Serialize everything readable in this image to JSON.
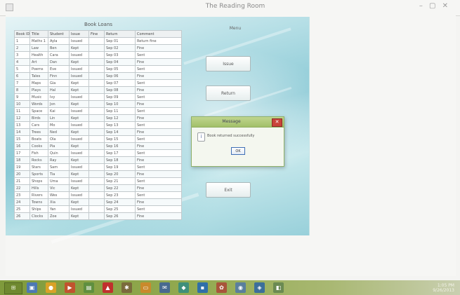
{
  "window": {
    "title": "The Reading Room",
    "controls": "– ▢ ✕"
  },
  "table": {
    "title": "Book Loans",
    "columns": [
      "Book ID",
      "Title",
      "Student",
      "Issue",
      "Fine",
      "Return",
      "Comment"
    ],
    "rows": [
      [
        "1",
        "Maths 1",
        "Ayla",
        "Issued",
        "",
        "Sep 01",
        "Return fine"
      ],
      [
        "2",
        "Law",
        "Ben",
        "Kept",
        "",
        "Sep 02",
        "Fine"
      ],
      [
        "3",
        "Health",
        "Cara",
        "Issued",
        "",
        "Sep 03",
        "Sent"
      ],
      [
        "4",
        "Art",
        "Dan",
        "Kept",
        "",
        "Sep 04",
        "Fine"
      ],
      [
        "5",
        "Poems",
        "Eve",
        "Issued",
        "",
        "Sep 05",
        "Sent"
      ],
      [
        "6",
        "Tales",
        "Finn",
        "Issued",
        "",
        "Sep 06",
        "Fine"
      ],
      [
        "7",
        "Maps",
        "Gia",
        "Kept",
        "",
        "Sep 07",
        "Sent"
      ],
      [
        "8",
        "Plays",
        "Hal",
        "Kept",
        "",
        "Sep 08",
        "Fine"
      ],
      [
        "9",
        "Music",
        "Ivy",
        "Issued",
        "",
        "Sep 09",
        "Sent"
      ],
      [
        "10",
        "Words",
        "Jon",
        "Kept",
        "",
        "Sep 10",
        "Fine"
      ],
      [
        "11",
        "Space",
        "Kai",
        "Issued",
        "",
        "Sep 11",
        "Sent"
      ],
      [
        "12",
        "Birds",
        "Lin",
        "Kept",
        "",
        "Sep 12",
        "Fine"
      ],
      [
        "13",
        "Cars",
        "Mo",
        "Issued",
        "",
        "Sep 13",
        "Sent"
      ],
      [
        "14",
        "Trees",
        "Ned",
        "Kept",
        "",
        "Sep 14",
        "Fine"
      ],
      [
        "15",
        "Boats",
        "Ola",
        "Issued",
        "",
        "Sep 15",
        "Sent"
      ],
      [
        "16",
        "Cooks",
        "Pia",
        "Kept",
        "",
        "Sep 16",
        "Fine"
      ],
      [
        "17",
        "Fish",
        "Quin",
        "Issued",
        "",
        "Sep 17",
        "Sent"
      ],
      [
        "18",
        "Rocks",
        "Ray",
        "Kept",
        "",
        "Sep 18",
        "Fine"
      ],
      [
        "19",
        "Stars",
        "Sam",
        "Issued",
        "",
        "Sep 19",
        "Sent"
      ],
      [
        "20",
        "Sports",
        "Tia",
        "Kept",
        "",
        "Sep 20",
        "Fine"
      ],
      [
        "21",
        "Shops",
        "Uma",
        "Issued",
        "",
        "Sep 21",
        "Sent"
      ],
      [
        "22",
        "Hills",
        "Vic",
        "Kept",
        "",
        "Sep 22",
        "Fine"
      ],
      [
        "23",
        "Rivers",
        "Wes",
        "Issued",
        "",
        "Sep 23",
        "Sent"
      ],
      [
        "24",
        "Towns",
        "Xia",
        "Kept",
        "",
        "Sep 24",
        "Fine"
      ],
      [
        "25",
        "Ships",
        "Yan",
        "Issued",
        "",
        "Sep 25",
        "Sent"
      ],
      [
        "26",
        "Clocks",
        "Zoe",
        "Kept",
        "",
        "Sep 26",
        "Fine"
      ]
    ]
  },
  "menu": {
    "label": "Menu",
    "buttons": [
      "Issue",
      "Return",
      "Exit"
    ]
  },
  "dialog": {
    "title": "Message",
    "message": "Book returned successfully",
    "ok_label": "OK",
    "close_glyph": "✕",
    "icon_glyph": "i"
  },
  "taskbar": {
    "start_glyph": "⊞",
    "icons": [
      {
        "name": "explorer-icon",
        "glyph": "▣",
        "color": "#4d79b3"
      },
      {
        "name": "browser-icon",
        "glyph": "●",
        "color": "#d9a227"
      },
      {
        "name": "media-icon",
        "glyph": "▶",
        "color": "#c1532e"
      },
      {
        "name": "notepad-icon",
        "glyph": "▤",
        "color": "#5f8f3f"
      },
      {
        "name": "pdf-icon",
        "glyph": "▲",
        "color": "#c0312d"
      },
      {
        "name": "settings-icon",
        "glyph": "✱",
        "color": "#7a6b3c"
      },
      {
        "name": "folder-icon",
        "glyph": "▭",
        "color": "#c98a2c"
      },
      {
        "name": "mail-icon",
        "glyph": "✉",
        "color": "#476a8f"
      },
      {
        "name": "chat-icon",
        "glyph": "◆",
        "color": "#3f8f7a"
      },
      {
        "name": "terminal-icon",
        "glyph": "▪",
        "color": "#2f6fa8"
      },
      {
        "name": "photos-icon",
        "glyph": "✿",
        "color": "#a8553a"
      },
      {
        "name": "app-icon",
        "glyph": "◉",
        "color": "#5a7f9c"
      },
      {
        "name": "network-icon",
        "glyph": "◈",
        "color": "#3c6f9a"
      },
      {
        "name": "store-icon",
        "glyph": "◧",
        "color": "#6b8a52"
      }
    ],
    "tray_time": "1:05 PM",
    "tray_date": "9/26/2013"
  }
}
